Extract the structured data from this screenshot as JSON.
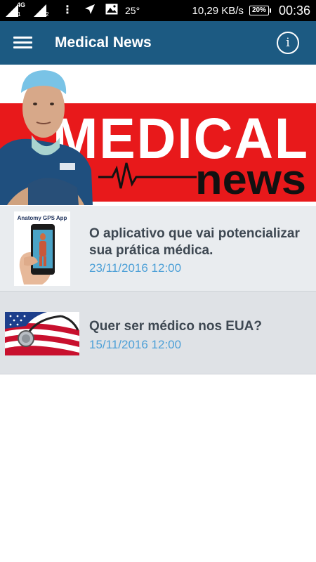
{
  "status_bar": {
    "network_type": "4G",
    "sim1": "1",
    "sim2": "2",
    "more": "⋮",
    "temperature": "25°",
    "net_speed": "10,29  KB/s",
    "battery": "20%",
    "time": "00:36"
  },
  "app_bar": {
    "title": "Medical News"
  },
  "banner": {
    "word_medical": "MEDICAL",
    "word_news": "news",
    "accent_color": "#e8191b"
  },
  "news": [
    {
      "title_line1": "O aplicativo que vai potencializar",
      "title_line2": "sua prática médica.",
      "date": "23/11/2016 12:00",
      "thumb_caption": "Anatomy GPS App"
    },
    {
      "title_line1": "Quer ser médico nos EUA?",
      "date": "15/11/2016 12:00"
    }
  ],
  "colors": {
    "app_bar": "#1c5a82",
    "date": "#4da0d7",
    "title": "#3e4852"
  }
}
